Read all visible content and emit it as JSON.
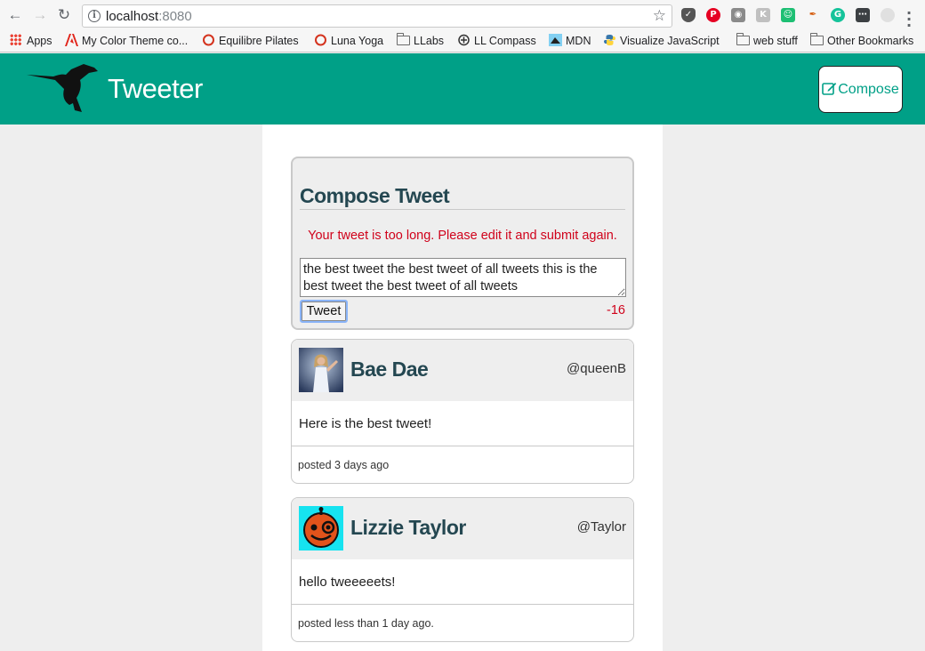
{
  "browser": {
    "url_host": "localhost",
    "url_port": ":8080",
    "bookmarks": [
      {
        "label": "Apps",
        "icon": "apps-grid-icon"
      },
      {
        "label": "My Color Theme co...",
        "icon": "adobe-icon"
      },
      {
        "label": "Equilibre Pilates",
        "icon": "circle-logo-icon"
      },
      {
        "label": "Luna Yoga",
        "icon": "circle-logo-icon"
      },
      {
        "label": "LLabs",
        "icon": "folder-icon"
      },
      {
        "label": "LL Compass",
        "icon": "compass-icon"
      },
      {
        "label": "MDN",
        "icon": "mdn-icon"
      },
      {
        "label": "Visualize JavaScript",
        "icon": "python-icon"
      },
      {
        "label": "web stuff",
        "icon": "folder-icon"
      },
      {
        "label": "Other Bookmarks",
        "icon": "folder-icon"
      }
    ]
  },
  "nav": {
    "brand": "Tweeter",
    "compose_label": "Compose",
    "accent_color": "#00a087"
  },
  "composer": {
    "title": "Compose Tweet",
    "error": "Your tweet is too long. Please edit it and submit again.",
    "text": "the best tweet the best tweet of all tweets this is the best tweet the best tweet of all tweets",
    "button_label": "Tweet",
    "counter": "-16"
  },
  "tweets": [
    {
      "name": "Bae Dae",
      "handle": "@queenB",
      "content": "Here is the best tweet!",
      "footer": "posted 3 days ago"
    },
    {
      "name": "Lizzie Taylor",
      "handle": "@Taylor",
      "content": "hello tweeeeets!",
      "footer": "posted less than 1 day ago."
    }
  ]
}
